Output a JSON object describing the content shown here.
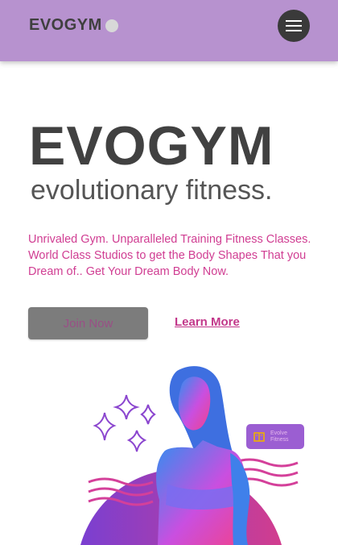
{
  "brand": {
    "nav_logo": "EVOGYM",
    "hero_logo": "EVOGYM",
    "hero_tagline": "evolutionary fitness."
  },
  "nav": {
    "menu_icon": "hamburger-menu-icon",
    "bar_color": "#b792cf"
  },
  "hero": {
    "description": "Unrivaled Gym. Unparalleled Training Fitness Classes. World Class Studios to get the Body Shapes That you Dream of.. Get Your Dream Body Now.",
    "join_label": "Join Now",
    "learn_label": "Learn More",
    "accent_color": "#c2378a",
    "badge_line1": "Evolve",
    "badge_line2": "Fitness",
    "badge_icon": "book-icon"
  }
}
